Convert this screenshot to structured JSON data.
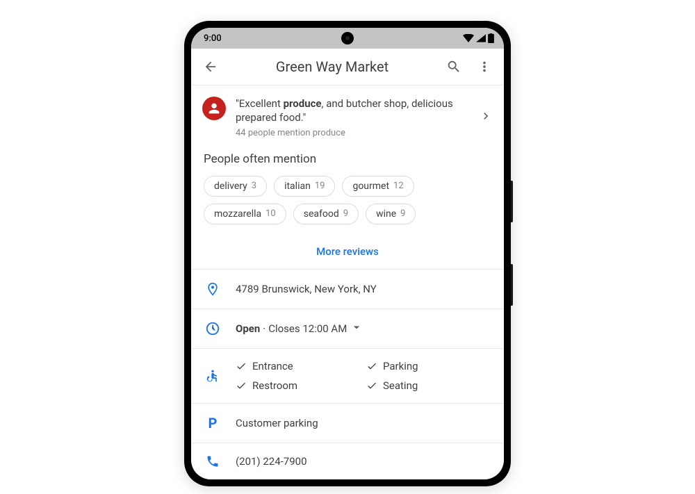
{
  "status_bar": {
    "time": "9:00"
  },
  "header": {
    "title": "Green Way Market"
  },
  "review_snippet": {
    "quote_pre": "\"Excellent ",
    "quote_bold": "produce",
    "quote_post": ", and butcher shop, delicious prepared food.\"",
    "footnote": "44 people mention produce"
  },
  "mentions": {
    "title": "People often mention",
    "chips": [
      {
        "label": "delivery",
        "count": "3"
      },
      {
        "label": "italian",
        "count": "19"
      },
      {
        "label": "gourmet",
        "count": "12"
      },
      {
        "label": "mozzarella",
        "count": "10"
      },
      {
        "label": "seafood",
        "count": "9"
      },
      {
        "label": "wine",
        "count": "9"
      }
    ],
    "more_label": "More reviews"
  },
  "info": {
    "address": "4789 Brunswick, New York, NY",
    "hours": {
      "status": "Open",
      "sep": " · ",
      "closes": "Closes 12:00 AM"
    },
    "accessibility": [
      "Entrance",
      "Parking",
      "Restroom",
      "Seating"
    ],
    "parking": "Customer parking",
    "parking_icon": "P",
    "phone": "(201) 224-7900"
  }
}
